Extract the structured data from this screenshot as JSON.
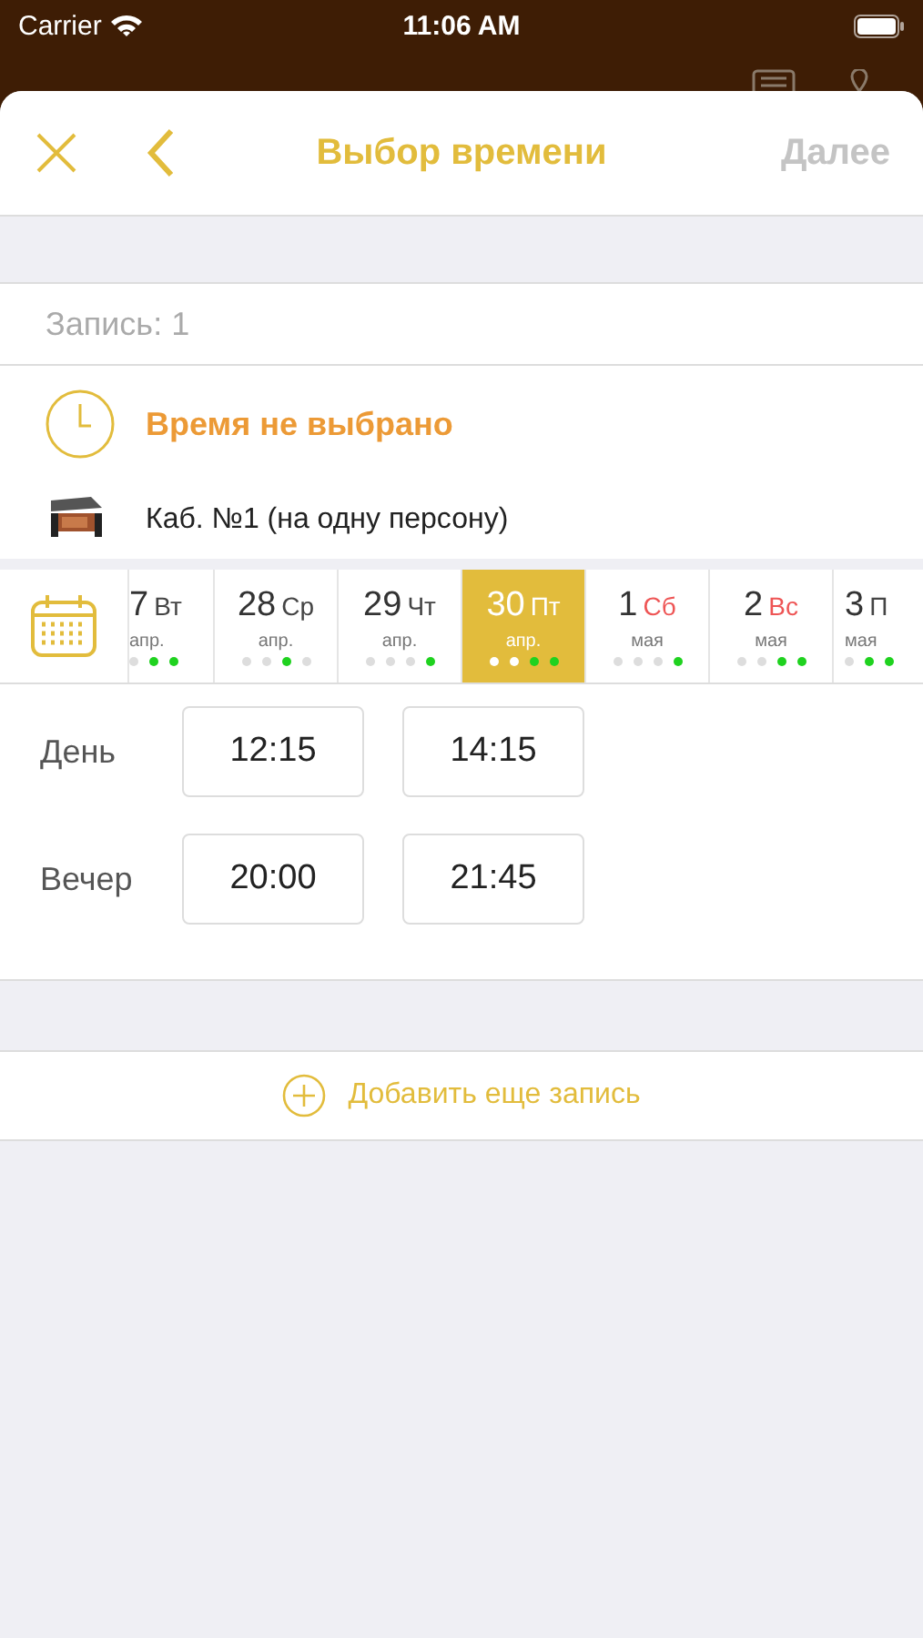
{
  "status_bar": {
    "carrier": "Carrier",
    "time": "11:06 AM"
  },
  "header": {
    "title": "Выбор времени",
    "next": "Далее",
    "next_disabled": true
  },
  "record": {
    "label": "Запись: 1"
  },
  "summary": {
    "time_status": "Время не выбрано",
    "room": "Каб. №1 (на одну персону)"
  },
  "days": [
    {
      "day": "7",
      "weekday": "Вт",
      "month": "апр.",
      "weekend": false,
      "selected": false,
      "slots": [
        false,
        true,
        true
      ]
    },
    {
      "day": "28",
      "weekday": "Ср",
      "month": "апр.",
      "weekend": false,
      "selected": false,
      "slots": [
        false,
        false,
        true,
        false
      ]
    },
    {
      "day": "29",
      "weekday": "Чт",
      "month": "апр.",
      "weekend": false,
      "selected": false,
      "slots": [
        false,
        false,
        false,
        true
      ]
    },
    {
      "day": "30",
      "weekday": "Пт",
      "month": "апр.",
      "weekend": false,
      "selected": true,
      "slots": [
        false,
        false,
        true,
        true
      ]
    },
    {
      "day": "1",
      "weekday": "Сб",
      "month": "мая",
      "weekend": true,
      "selected": false,
      "slots": [
        false,
        false,
        false,
        true
      ]
    },
    {
      "day": "2",
      "weekday": "Вс",
      "month": "мая",
      "weekend": true,
      "selected": false,
      "slots": [
        false,
        false,
        true,
        true
      ]
    },
    {
      "day": "3",
      "weekday": "П",
      "month": "мая",
      "weekend": false,
      "selected": false,
      "slots": [
        false,
        true,
        true
      ]
    }
  ],
  "periods": [
    {
      "label": "День",
      "times": [
        "12:15",
        "14:15"
      ]
    },
    {
      "label": "Вечер",
      "times": [
        "20:00",
        "21:45"
      ]
    }
  ],
  "add_record": "Добавить еще запись"
}
